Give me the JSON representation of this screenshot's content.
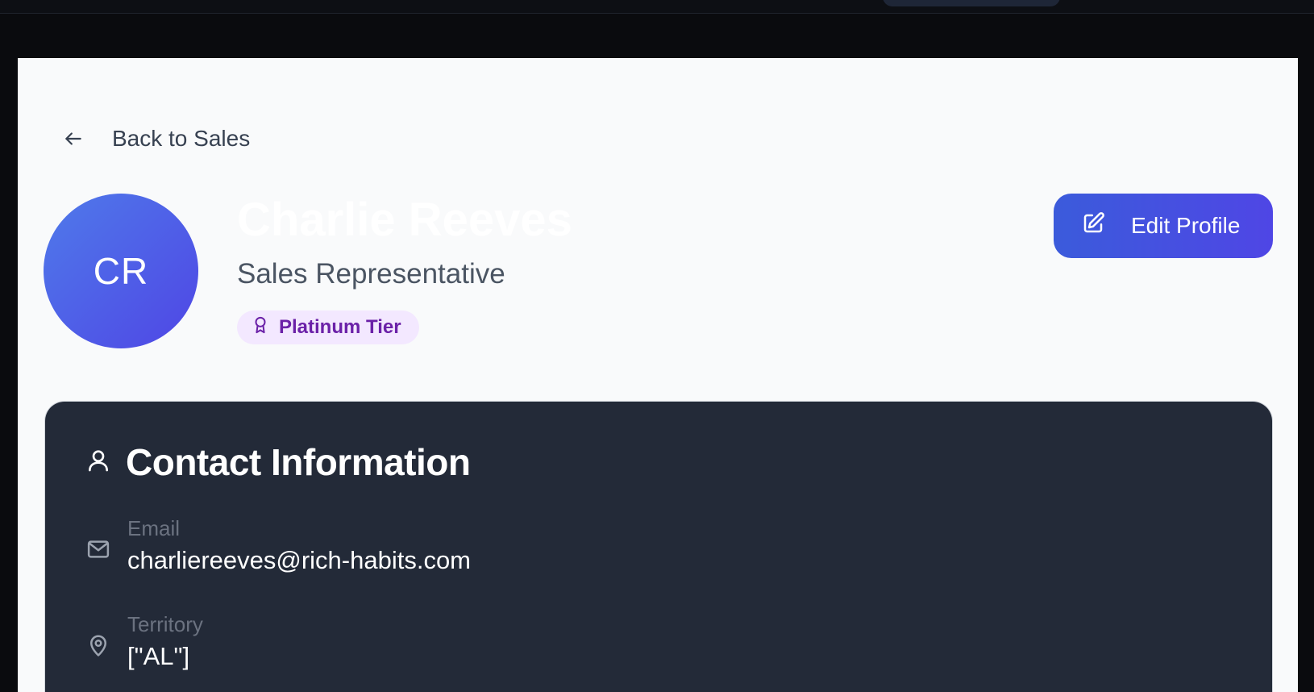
{
  "nav": {
    "back_label": "Back to Sales"
  },
  "profile": {
    "initials": "CR",
    "name": "Charlie Reeves",
    "role": "Sales Representative",
    "tier": "Platinum Tier"
  },
  "actions": {
    "edit_label": "Edit Profile"
  },
  "contact": {
    "title": "Contact Information",
    "email_label": "Email",
    "email_value": "charliereeves@rich-habits.com",
    "territory_label": "Territory",
    "territory_value": "[\"AL\"]"
  },
  "icons": [
    "arrow-left-icon",
    "award-icon",
    "pencil-square-icon",
    "user-icon",
    "mail-icon",
    "map-pin-icon"
  ],
  "colors": {
    "accent": "#4f46e5",
    "badge_bg": "#f3e8ff",
    "badge_text": "#6b21a8",
    "card_bg": "#232a38"
  }
}
